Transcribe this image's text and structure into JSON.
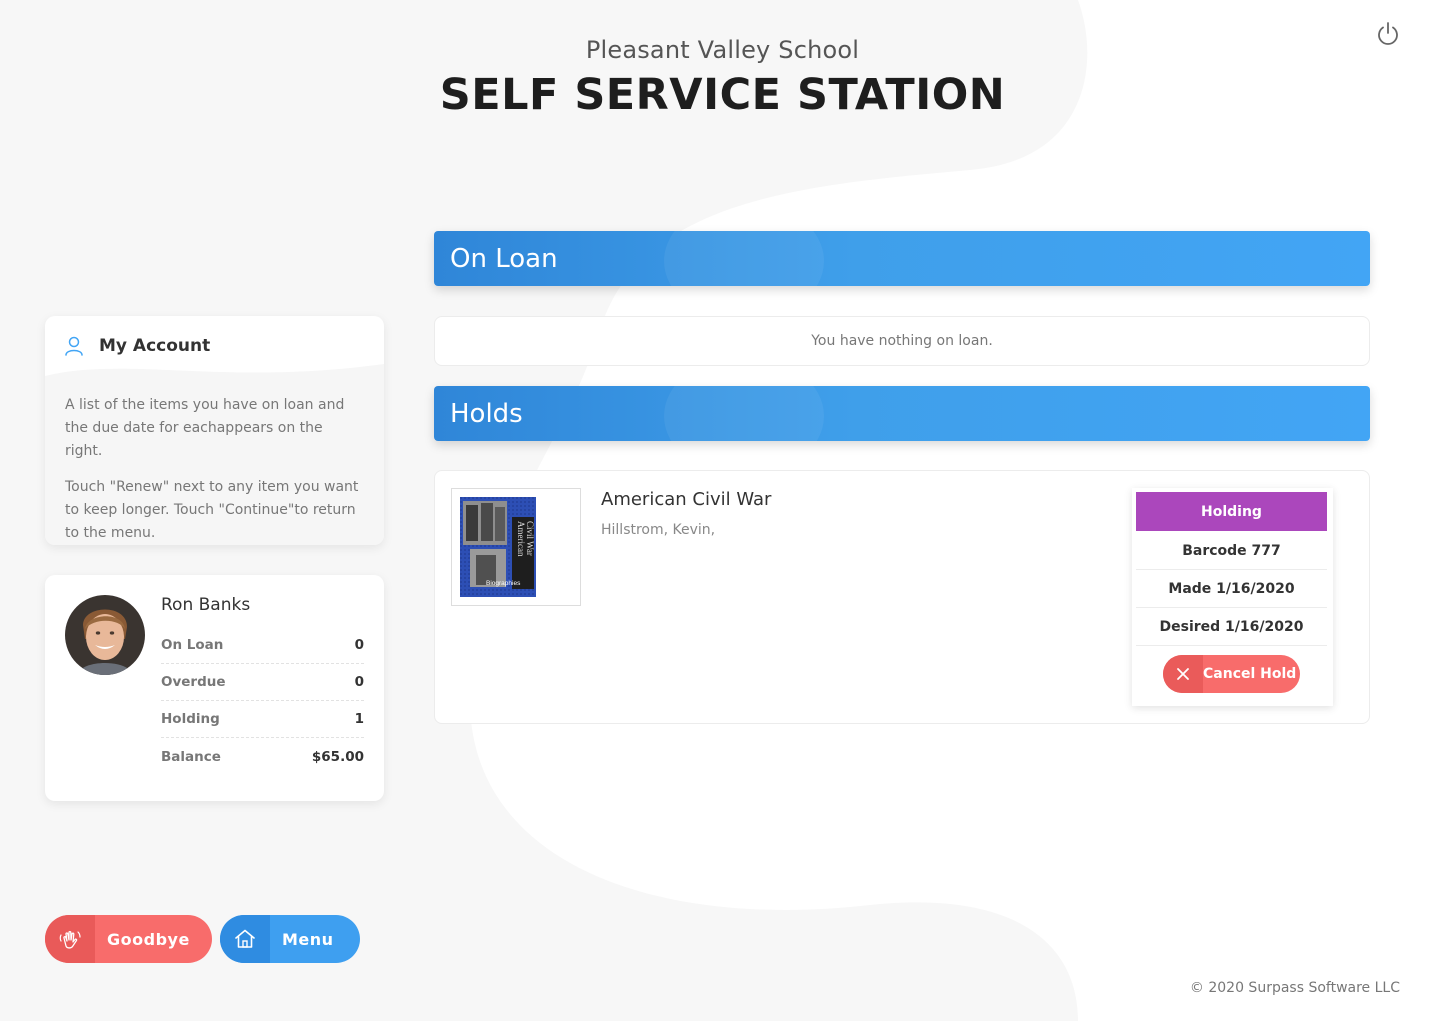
{
  "header": {
    "school_name": "Pleasant Valley School",
    "station_title": "SELF SERVICE STATION"
  },
  "account": {
    "title": "My Account",
    "paragraph_1": "A list of the items you have on loan and the due date for eachappears on the right.",
    "paragraph_2": "Touch \"Renew\" next to any item you want to keep longer. Touch \"Continue\"to return to the menu."
  },
  "profile": {
    "name": "Ron Banks",
    "stats": [
      {
        "label": "On Loan",
        "value": "0"
      },
      {
        "label": "Overdue",
        "value": "0"
      },
      {
        "label": "Holding",
        "value": "1"
      },
      {
        "label": "Balance",
        "value": "$65.00"
      }
    ]
  },
  "buttons": {
    "goodbye": "Goodbye",
    "menu": "Menu"
  },
  "on_loan": {
    "title": "On Loan",
    "empty_message": "You have nothing on loan."
  },
  "holds": {
    "title": "Holds",
    "items": [
      {
        "title": "American Civil War",
        "author": "Hillstrom, Kevin,",
        "cover_text_1": "American",
        "cover_text_2": "Civil War",
        "cover_text_3": "Biographies",
        "status": "Holding",
        "barcode": "Barcode 777",
        "made": "Made 1/16/2020",
        "desired": "Desired 1/16/2020",
        "cancel_label": "Cancel Hold"
      }
    ]
  },
  "footer": {
    "copyright": "© 2020 Surpass Software LLC"
  },
  "colors": {
    "accent_blue": "#42a5f5",
    "accent_red": "#f86c6b",
    "holding_purple": "#ab47bc"
  },
  "icons": {
    "power": "power-icon",
    "user": "user-icon",
    "wave": "wave-hand-icon",
    "home": "home-icon",
    "close": "close-icon"
  }
}
